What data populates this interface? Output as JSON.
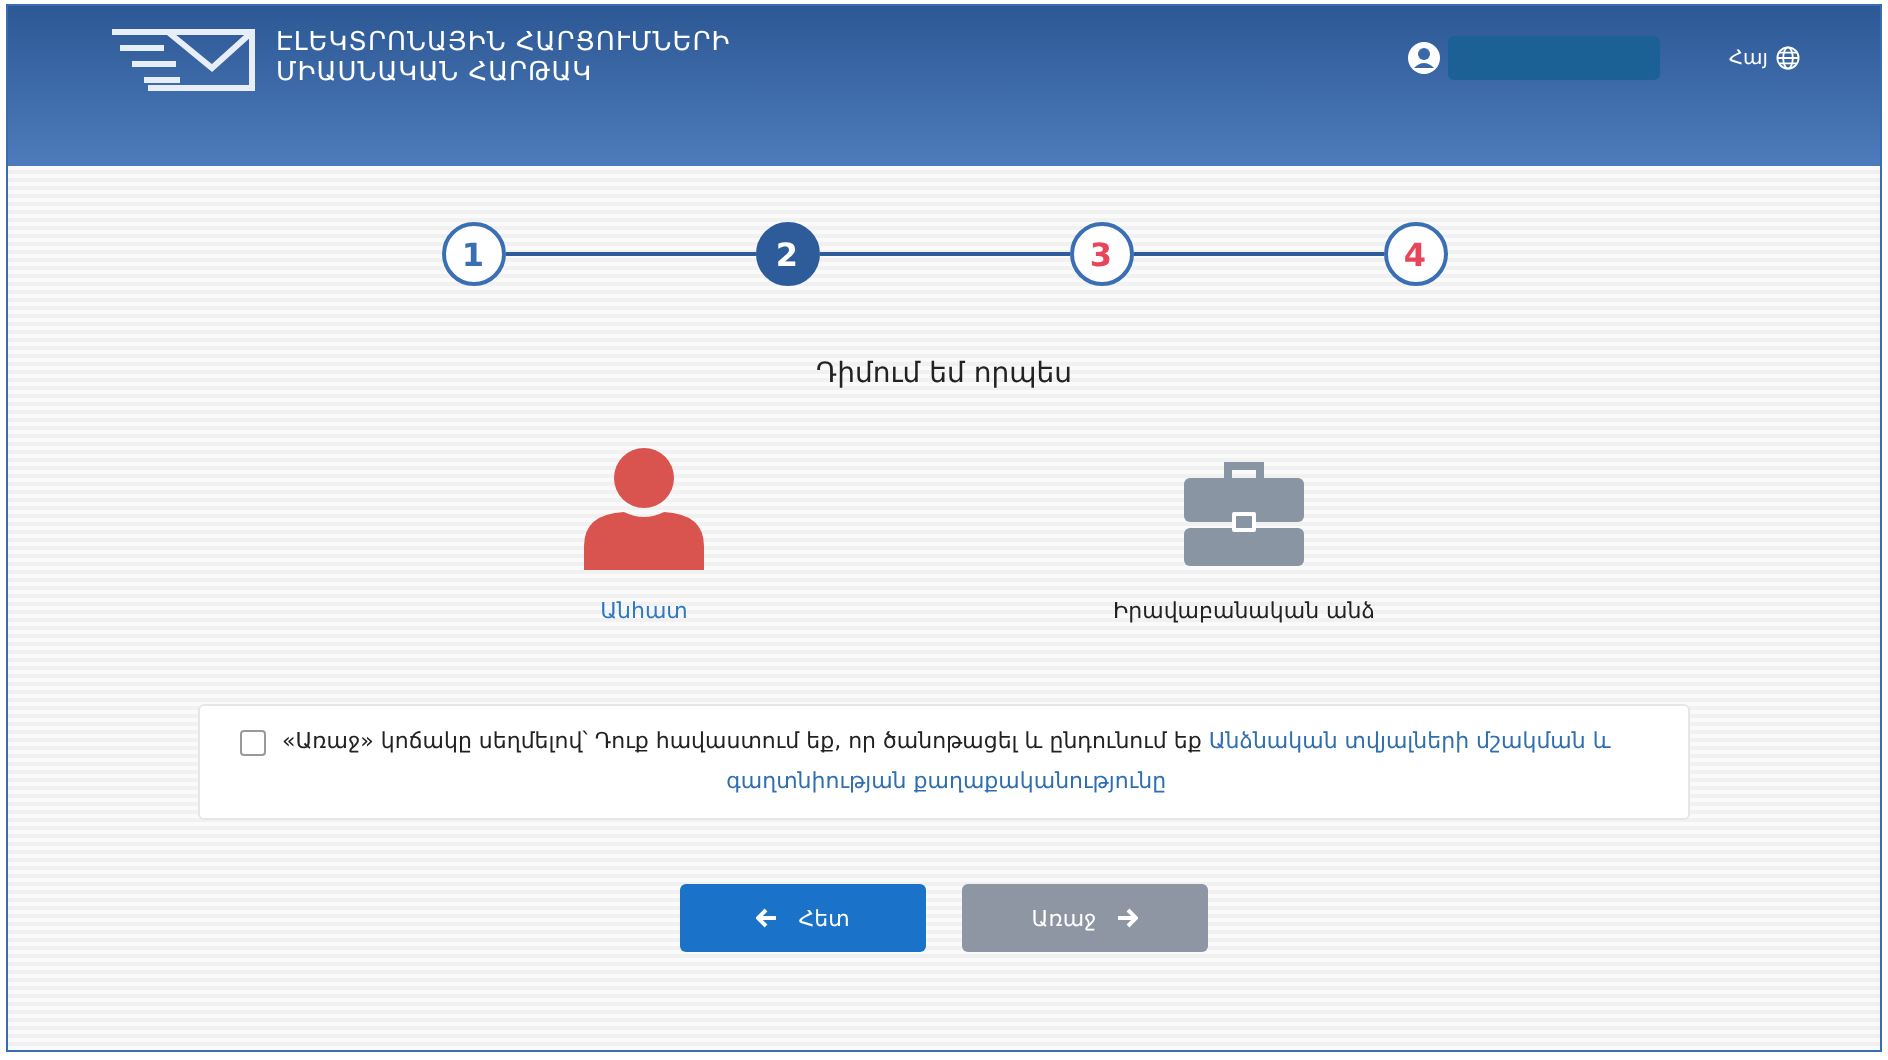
{
  "header": {
    "title_lines": [
      "ԷԼԵԿՏՐՈՆԱՅԻՆ ՀԱՐՑՈՒՄՆԵՐԻ",
      "ՄԻԱՍՆԱԿԱՆ ՀԱՐԹԱԿ"
    ],
    "language": "Հայ"
  },
  "steps": [
    {
      "label": "1",
      "selected": false,
      "done": true
    },
    {
      "label": "2",
      "selected": true
    },
    {
      "label": "3",
      "selected": false,
      "done": false
    },
    {
      "label": "4",
      "selected": false,
      "done": false
    }
  ],
  "heading": "Դիմում եմ որպես",
  "applicant_types": [
    {
      "kind": "person",
      "label": "Անհատ",
      "selected": true
    },
    {
      "kind": "company",
      "label": "Իրավաբանական անձ",
      "selected": false
    }
  ],
  "consent": {
    "checked": false,
    "text": "«Առաջ» կոճակը սեղմելով՝ Դուք հավաստում եք, որ ծանոթացել և ընդունում եք",
    "link_lines": [
      "Անձնական տվյալների մշակման և",
      "գաղտնիության քաղաքականությունը"
    ]
  },
  "buttons": [
    {
      "kind": "back",
      "label": "Հետ",
      "disabled": false
    },
    {
      "kind": "next",
      "label": "Առաջ",
      "disabled": true
    }
  ]
}
